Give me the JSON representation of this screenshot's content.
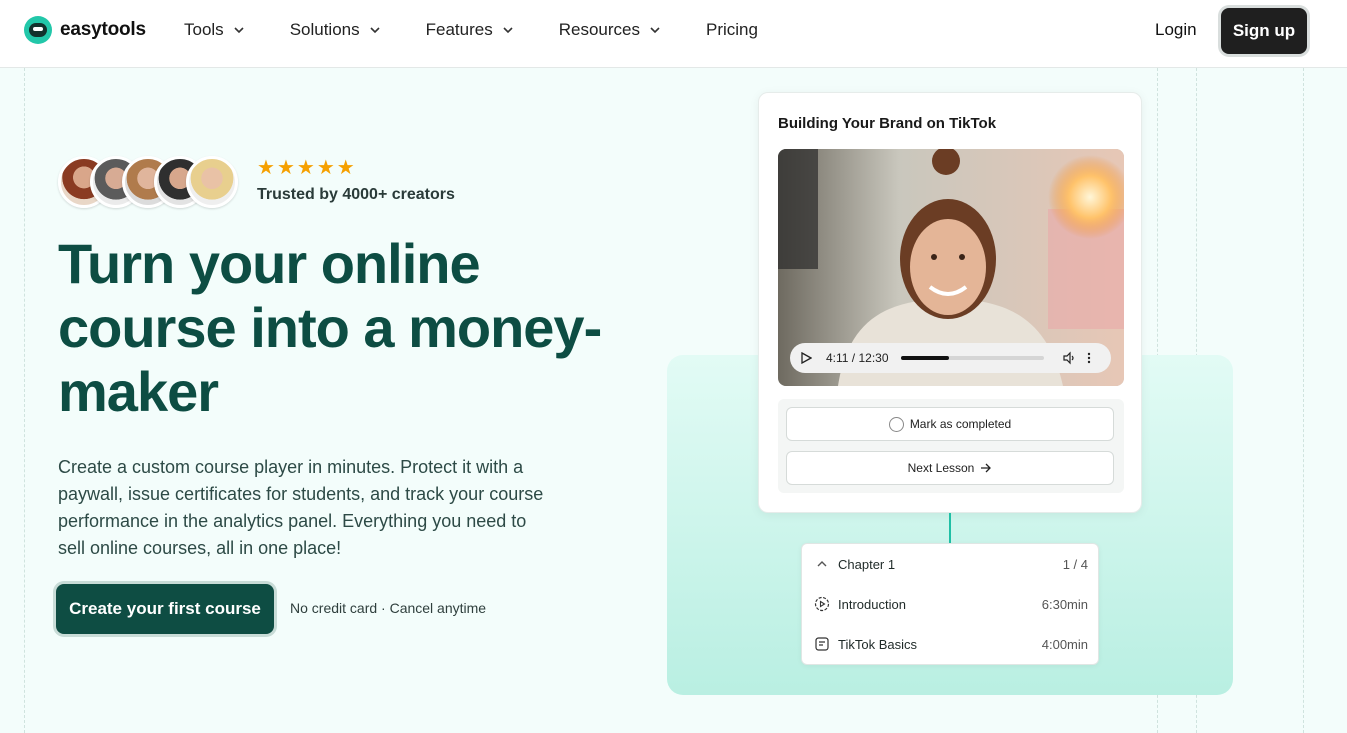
{
  "header": {
    "brand": "easytools",
    "nav": [
      {
        "label": "Tools",
        "dropdown": true
      },
      {
        "label": "Solutions",
        "dropdown": true
      },
      {
        "label": "Features",
        "dropdown": true
      },
      {
        "label": "Resources",
        "dropdown": true
      },
      {
        "label": "Pricing",
        "dropdown": false
      }
    ],
    "login_label": "Login",
    "signup_label": "Sign up"
  },
  "hero": {
    "rating_stars": 5,
    "trusted_text": "Trusted by 4000+ creators",
    "headline": "Turn your online course into a money-maker",
    "subtext": "Create a custom course player in minutes. Protect it with a paywall, issue certificates for students, and track your course performance in the analytics panel. Everything you need to sell online courses, all in one place!",
    "cta_label": "Create your first course",
    "cta_note": "No credit card · Cancel anytime"
  },
  "player": {
    "title": "Building Your Brand on TikTok",
    "time": "4:11 / 12:30",
    "progress": 0.34,
    "mark_completed_label": "Mark as completed",
    "next_lesson_label": "Next Lesson"
  },
  "chapter": {
    "title": "Chapter 1",
    "count": "1 / 4",
    "lessons": [
      {
        "title": "Introduction",
        "duration": "6:30min",
        "icon": "video-lesson-icon"
      },
      {
        "title": "TikTok Basics",
        "duration": "4:00min",
        "icon": "text-lesson-icon"
      }
    ]
  },
  "colors": {
    "brand_accent": "#22c7a9",
    "headline": "#0d4d43",
    "cta": "#0e4d43",
    "star": "#f5a000"
  }
}
